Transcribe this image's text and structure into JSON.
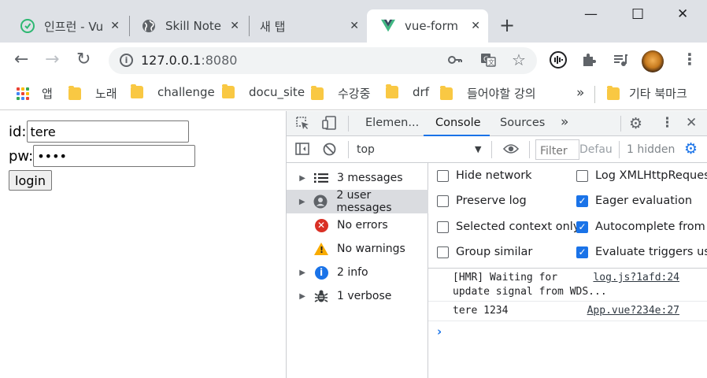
{
  "tabs": [
    {
      "title": "인프런 - Vu",
      "close": "✕"
    },
    {
      "title": "Skill Note",
      "close": "✕"
    },
    {
      "title": "새 탭",
      "close": "✕"
    },
    {
      "title": "vue-form",
      "close": "✕"
    }
  ],
  "new_tab": "+",
  "window_controls": {
    "minimize": "—",
    "maximize": "☐",
    "close": "✕"
  },
  "nav": {
    "back": "←",
    "forward": "→",
    "reload": "↻"
  },
  "address": {
    "host": "127.0.0.1",
    "port": ":8080"
  },
  "bookmarks": {
    "apps_label": "앱",
    "items": [
      "노래",
      "challenge",
      "docu_site",
      "수강중",
      "drf",
      "들어야할 강의"
    ],
    "more": "»",
    "other": "기타 북마크"
  },
  "app_colors": [
    "#ea4335",
    "#fbbc04",
    "#34a853",
    "#4285f4",
    "#ea4335",
    "#fbbc04",
    "#34a853",
    "#4285f4",
    "#ea4335"
  ],
  "form": {
    "id_label": "id:",
    "id_value": "tere",
    "pw_label": "pw:",
    "pw_value": "1234",
    "login_label": "login"
  },
  "devtools": {
    "tabs": [
      "Elemen...",
      "Console",
      "Sources"
    ],
    "active_tab": "Console",
    "more_tabs": "»",
    "context": "top",
    "filter_placeholder": "Filter",
    "levels": "Defau",
    "hidden_count": "1 hidden",
    "sidebar": [
      {
        "label": "3 messages",
        "icon": "list-icon",
        "expandable": true
      },
      {
        "label": "2 user messages",
        "icon": "user-icon",
        "expandable": true,
        "selected": true
      },
      {
        "label": "No errors",
        "icon": "error-icon",
        "expandable": false
      },
      {
        "label": "No warnings",
        "icon": "warning-icon",
        "expandable": false
      },
      {
        "label": "2 info",
        "icon": "info-icon",
        "expandable": true
      },
      {
        "label": "1 verbose",
        "icon": "bug-icon",
        "expandable": true
      }
    ],
    "settings": {
      "hide_network": {
        "label": "Hide network",
        "checked": false
      },
      "preserve_log": {
        "label": "Preserve log",
        "checked": false
      },
      "selected_context": {
        "label": "Selected context only",
        "checked": false
      },
      "group_similar": {
        "label": "Group similar",
        "checked": false
      },
      "log_xhr": {
        "label": "Log XMLHttpRequests",
        "checked": false
      },
      "eager_eval": {
        "label": "Eager evaluation",
        "checked": true
      },
      "autocomplete": {
        "label": "Autocomplete from history",
        "checked": true
      },
      "evaluate_triggers": {
        "label": "Evaluate triggers user activation",
        "checked": true
      }
    },
    "messages": [
      {
        "text": "[HMR] Waiting for\nupdate signal from WDS...",
        "source": "log.js?1afd:24"
      },
      {
        "text": "tere 1234",
        "source": "App.vue?234e:27"
      }
    ],
    "prompt": "›"
  },
  "colors": {
    "accent": "#1a73e8",
    "error": "#d93025",
    "warning": "#f9ab00",
    "info": "#1a73e8",
    "vue_green": "#41b883"
  }
}
